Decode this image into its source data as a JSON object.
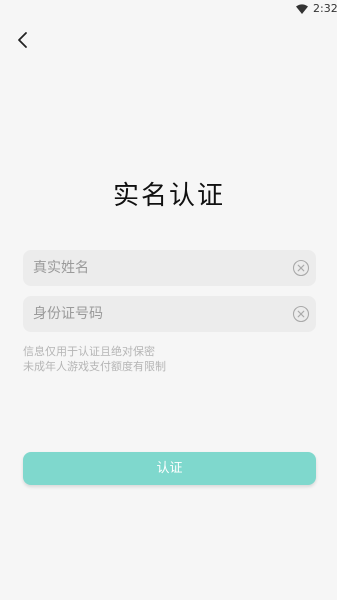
{
  "status_bar": {
    "time": "2:32",
    "wifi_icon": "wifi-icon"
  },
  "header": {
    "back_icon": "chevron-left-icon"
  },
  "page": {
    "title": "实名认证"
  },
  "form": {
    "name_placeholder": "真实姓名",
    "name_value": "",
    "id_placeholder": "身份证号码",
    "id_value": "",
    "clear_icon": "clear-circle-icon"
  },
  "notice": {
    "line1": "信息仅用于认证且绝对保密",
    "line2": "未成年人游戏支付额度有限制"
  },
  "submit": {
    "label": "认证"
  },
  "colors": {
    "accent": "#7fd8cd",
    "background": "#f6f6f6",
    "field_bg": "#ececec",
    "hint_text": "#b5b5b5"
  }
}
